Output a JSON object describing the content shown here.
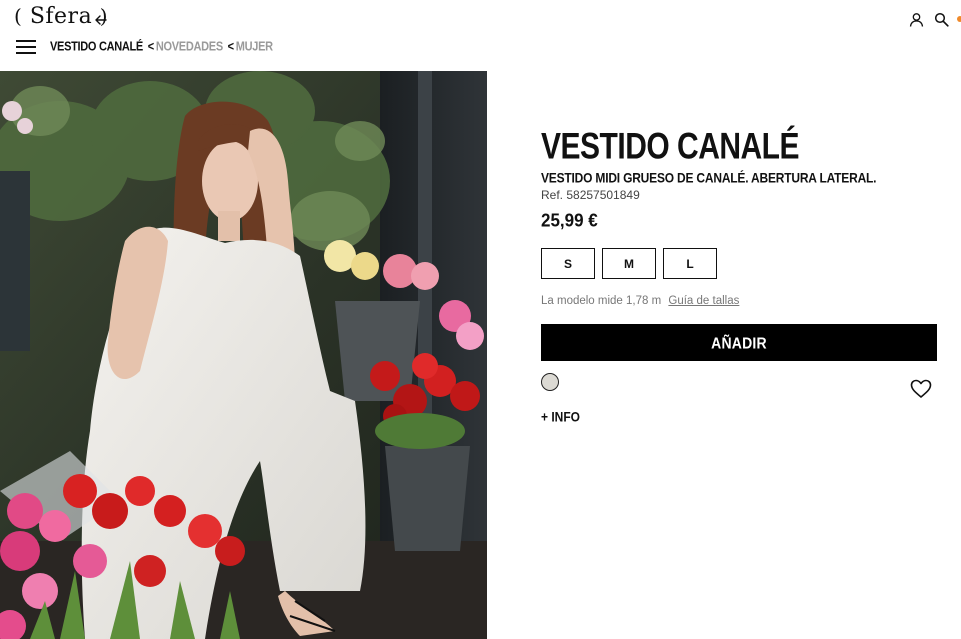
{
  "header": {
    "logo_text": "Sfera",
    "breadcrumb": {
      "current": "VESTIDO CANALÉ",
      "separator": "<",
      "items": [
        "NOVEDADES",
        "MUJER"
      ]
    },
    "icons": [
      "back-arrow-icon",
      "menu-icon",
      "user-icon",
      "search-icon"
    ],
    "accent_color": "#f08a2a"
  },
  "product": {
    "title": "VESTIDO CANALÉ",
    "subtitle": "VESTIDO MIDI GRUESO DE CANALÉ. ABERTURA LATERAL.",
    "ref": "Ref. 58257501849",
    "price": "25,99 €",
    "sizes": [
      "S",
      "M",
      "L"
    ],
    "model_note": "La modelo mide 1,78 m",
    "size_guide_label": "Guía de tallas",
    "add_button_label": "AÑADIR",
    "color_swatch": "#dcdad4",
    "more_info_label": "+ INFO"
  }
}
